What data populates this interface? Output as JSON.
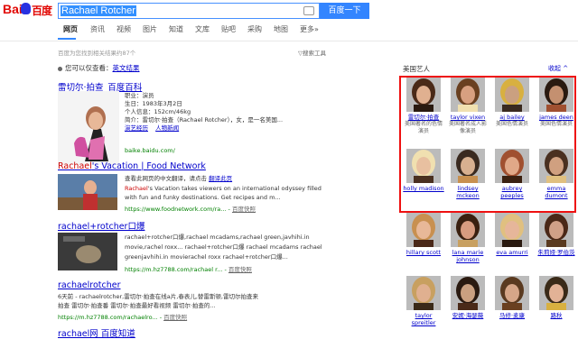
{
  "search": {
    "query": "Rachael Rotcher",
    "button": "百度一下"
  },
  "tabs": [
    {
      "label": "网页"
    },
    {
      "label": "资讯"
    },
    {
      "label": "视频"
    },
    {
      "label": "图片"
    },
    {
      "label": "知道"
    },
    {
      "label": "文库"
    },
    {
      "label": "贴吧"
    },
    {
      "label": "采购"
    },
    {
      "label": "地图"
    },
    {
      "label": "更多»"
    }
  ],
  "stat": "百度为您找到相关结果约87个",
  "tools": "搜索工具",
  "only": {
    "prefix": "您可以仅查看：",
    "link": "英文结果"
  },
  "results": [
    {
      "title": "雷切尔·拍查_百度百科",
      "lines": [
        "职业：演员",
        "生日：1983年3月2日",
        "个人信息：152cm/46kg"
      ],
      "intro": "简介：雷切尔·拍查（Rachael Rotcher），女，是一名美国...",
      "links": [
        "演艺经历",
        "人物新闻"
      ],
      "url": "baike.baidu.com/"
    },
    {
      "title": "Rachael's Vacation | Food Network",
      "title_red": "Rachael",
      "title_rest": "'s Vacation | Food Network",
      "translate": "查看此网页的中文翻译，请点击",
      "translate_link": "翻译此页",
      "lines": [
        "'s Vacation takes viewers on an international odyssey filled",
        "with fun and funky destinations. Get recipes and m..."
      ],
      "line1_red": "Rachael",
      "url": "https://www.foodnetwork.com/ra...",
      "snap": "百度快照"
    },
    {
      "title": "rachael+rotcher口爆",
      "lines": [
        "rachael+rotcher口爆,rachael mcadams,rachael green,javhihi.in",
        "movie,rachel roxx... rachael+rotcher口爆 rachael mcadams rachael",
        "greenjavhihi.in movierachel roxx rachael+rotcher口爆..."
      ],
      "url": "https://m.hz7788.com/rachael r...",
      "snap": "百度快照"
    },
    {
      "title": "rachaelrotcher",
      "lines": [
        "6天前 - rachaelrotcher,雷切尔·拍查在线a片,春表儿,替雷斯顿,雷切尔拍查来",
        "拍查 雷切尔·拍查番 雷切尔·拍查最好看视频 雷切尔·拍查的..."
      ],
      "url": "https://m.hz7788.com/rachaelro...",
      "snap": "百度快照"
    },
    {
      "title": "rachael网 百度知道"
    }
  ],
  "panel": {
    "title": "美国艺人",
    "collapse": "收起 ^",
    "people": [
      {
        "name": "雷切尔·拍查",
        "desc": "美国著名的色情演员"
      },
      {
        "name": "taylor vixen",
        "desc": "美国著名成人影像演员"
      },
      {
        "name": "aj bailey",
        "desc": "美国色情演员"
      },
      {
        "name": "james deen",
        "desc": "美国色情演员"
      },
      {
        "name": "holly madison",
        "desc": ""
      },
      {
        "name": "lindsey mckeon",
        "desc": ""
      },
      {
        "name": "aubrey peeples",
        "desc": ""
      },
      {
        "name": "emma dumont",
        "desc": ""
      },
      {
        "name": "hillary scott",
        "desc": ""
      },
      {
        "name": "lana marie johnson",
        "desc": ""
      },
      {
        "name": "eva amurri",
        "desc": ""
      },
      {
        "name": "朱莉娅·罗伯茨",
        "desc": ""
      },
      {
        "name": "taylor spreitler",
        "desc": ""
      },
      {
        "name": "安妮·海瑟薇",
        "desc": ""
      },
      {
        "name": "马修·麦康",
        "desc": ""
      },
      {
        "name": "路秋",
        "desc": ""
      }
    ]
  },
  "colors": {
    "link": "#0000cc",
    "url": "#008000",
    "accent": "#3385ff",
    "highlight_box": "#e11111"
  }
}
